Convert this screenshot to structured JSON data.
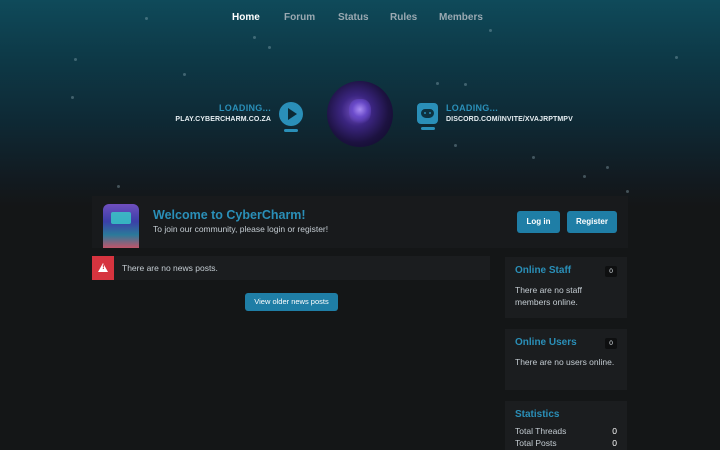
{
  "nav": {
    "items": [
      "Home",
      "Forum",
      "Status",
      "Rules",
      "Members"
    ],
    "active": "Home"
  },
  "hero": {
    "server": {
      "status": "LOADING...",
      "address": "PLAY.CYBERCHARM.CO.ZA",
      "icon": "play-icon"
    },
    "discord": {
      "status": "LOADING...",
      "address": "DISCORD.COM/INVITE/XVAJRPTMPV",
      "icon": "discord-icon"
    }
  },
  "welcome": {
    "title": "Welcome to CyberCharm!",
    "subtitle": "To join our community, please login or register!",
    "login_label": "Log in",
    "register_label": "Register"
  },
  "news": {
    "empty_text": "There are no news posts.",
    "older_label": "View older news posts",
    "alert_icon": "warning-icon"
  },
  "sidebar": {
    "online_staff": {
      "title": "Online Staff",
      "count": "0",
      "text": "There are no staff members online."
    },
    "online_users": {
      "title": "Online Users",
      "count": "0",
      "text": "There are no users online."
    },
    "statistics": {
      "title": "Statistics",
      "rows": [
        {
          "label": "Total Threads",
          "value": "0"
        },
        {
          "label": "Total Posts",
          "value": "0"
        }
      ]
    }
  },
  "colors": {
    "accent": "#2a8fb8",
    "button": "#1f7ea6",
    "alert": "#d6343f",
    "card": "#1b1d1f",
    "page": "#141617"
  }
}
